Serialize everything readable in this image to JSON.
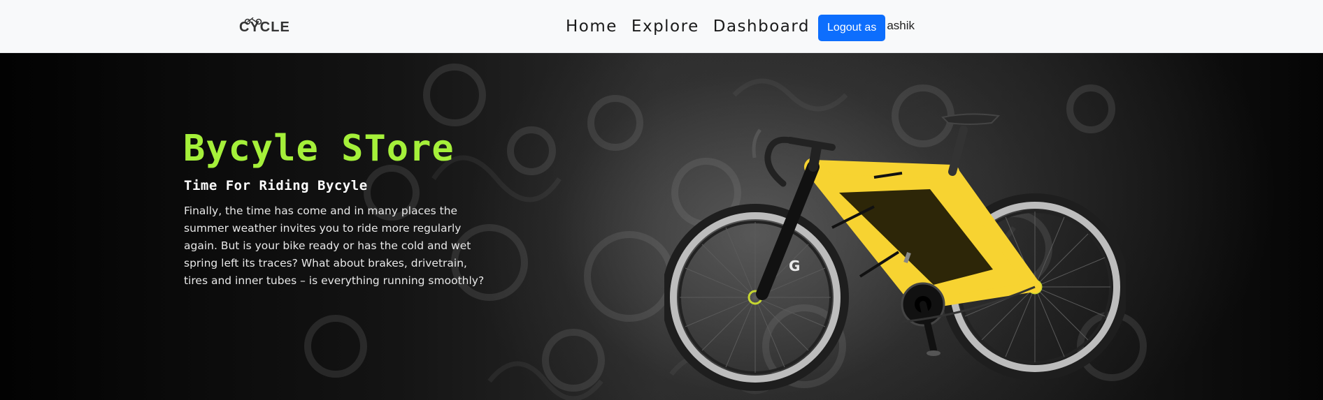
{
  "nav": {
    "logo_text": "CYCLE",
    "links": [
      "Home",
      "Explore",
      "Dashboard"
    ],
    "logout_label": "Logout as",
    "username": "ashik"
  },
  "hero": {
    "title": "Bycyle STore",
    "subtitle": "Time For Riding Bycyle",
    "description": "Finally, the time has come and in many places the summer weather invites you to ride more regularly again. But is your bike ready or has the cold and wet spring left its traces? What about brakes, drivetrain, tires and inner tubes – is everything running smoothly?"
  },
  "colors": {
    "title_green": "#a5f03a",
    "button_blue": "#0d6efd",
    "bike_frame": "#f7d331",
    "navbar_bg": "#f8f9fa"
  },
  "icons": {
    "logo": "bicycle-logo-icon",
    "hero_image": "road-bicycle-illustration"
  }
}
